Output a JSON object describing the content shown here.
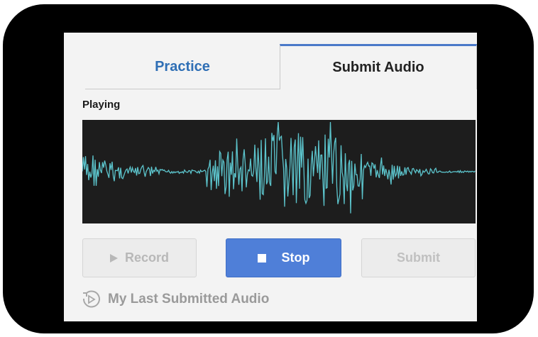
{
  "tabs": [
    {
      "label": "Practice",
      "active": false
    },
    {
      "label": "Submit Audio",
      "active": true
    }
  ],
  "status_text": "Playing",
  "waveform": {
    "color": "#5cc4cc",
    "background": "#1d1d1d"
  },
  "buttons": {
    "record": {
      "label": "Record",
      "icon": "play-icon",
      "enabled": false
    },
    "stop": {
      "label": "Stop",
      "icon": "stop-icon",
      "enabled": true
    },
    "submit": {
      "label": "Submit",
      "enabled": false
    }
  },
  "last_submitted": {
    "label": "My Last Submitted Audio",
    "icon": "replay-icon"
  },
  "colors": {
    "accent": "#4f7fd8",
    "tab_link": "#2f6fb5",
    "frame": "#000000"
  }
}
